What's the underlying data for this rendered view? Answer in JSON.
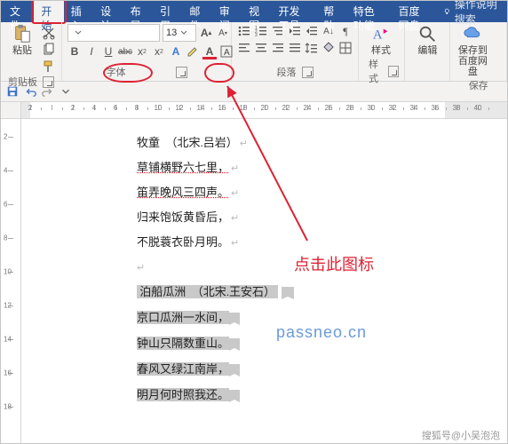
{
  "menu": {
    "file": "文件",
    "tabs": [
      "开始",
      "插入",
      "设计",
      "布局",
      "引用",
      "邮件",
      "审阅",
      "视图",
      "开发工具",
      "帮助",
      "特色功能",
      "百度网盘"
    ],
    "active_index": 0,
    "tell_me": "操作说明搜索"
  },
  "ribbon": {
    "clipboard": {
      "paste": "粘贴",
      "label": "剪贴板"
    },
    "font": {
      "family_value": "",
      "size_value": "13",
      "bold": "B",
      "italic": "I",
      "underline": "U",
      "strike": "abc",
      "label": "字体"
    },
    "paragraph": {
      "label": "段落"
    },
    "styles": {
      "label": "样式"
    },
    "editing": {
      "label": "编辑"
    },
    "baidu": {
      "save": "保存到",
      "line2": "百度网盘",
      "label": "保存"
    }
  },
  "qat": {
    "items": [
      "save",
      "undo",
      "redo",
      "dd"
    ]
  },
  "ruler": {
    "labels": [
      "2",
      "",
      "2",
      "4",
      "6",
      "8",
      "10",
      "12",
      "14",
      "16",
      "18",
      "20",
      "22",
      "24",
      "26",
      "28",
      "30",
      "32",
      "34",
      "36",
      "38",
      "40"
    ]
  },
  "vruler": {
    "labels": [
      "2",
      "4",
      "6",
      "8",
      "10",
      "12",
      "14",
      "16",
      "18"
    ]
  },
  "doc": {
    "title": "牧童　（北宋.吕岩）",
    "lines": [
      "草铺横野六七里，",
      "笛弄晚风三四声。",
      "归来饱饭黄昏后，",
      "不脱蓑衣卧月明。"
    ],
    "spacer": "",
    "title2": "泊船瓜洲　（北宋.王安石）",
    "lines2": [
      "京口瓜洲一水间，",
      "钟山只隔数重山。",
      "春风又绿江南岸，",
      "明月何时照我还。"
    ]
  },
  "callout": "点击此图标",
  "watermark": "passneo.cn",
  "credit": "搜狐号@小吴泡泡"
}
